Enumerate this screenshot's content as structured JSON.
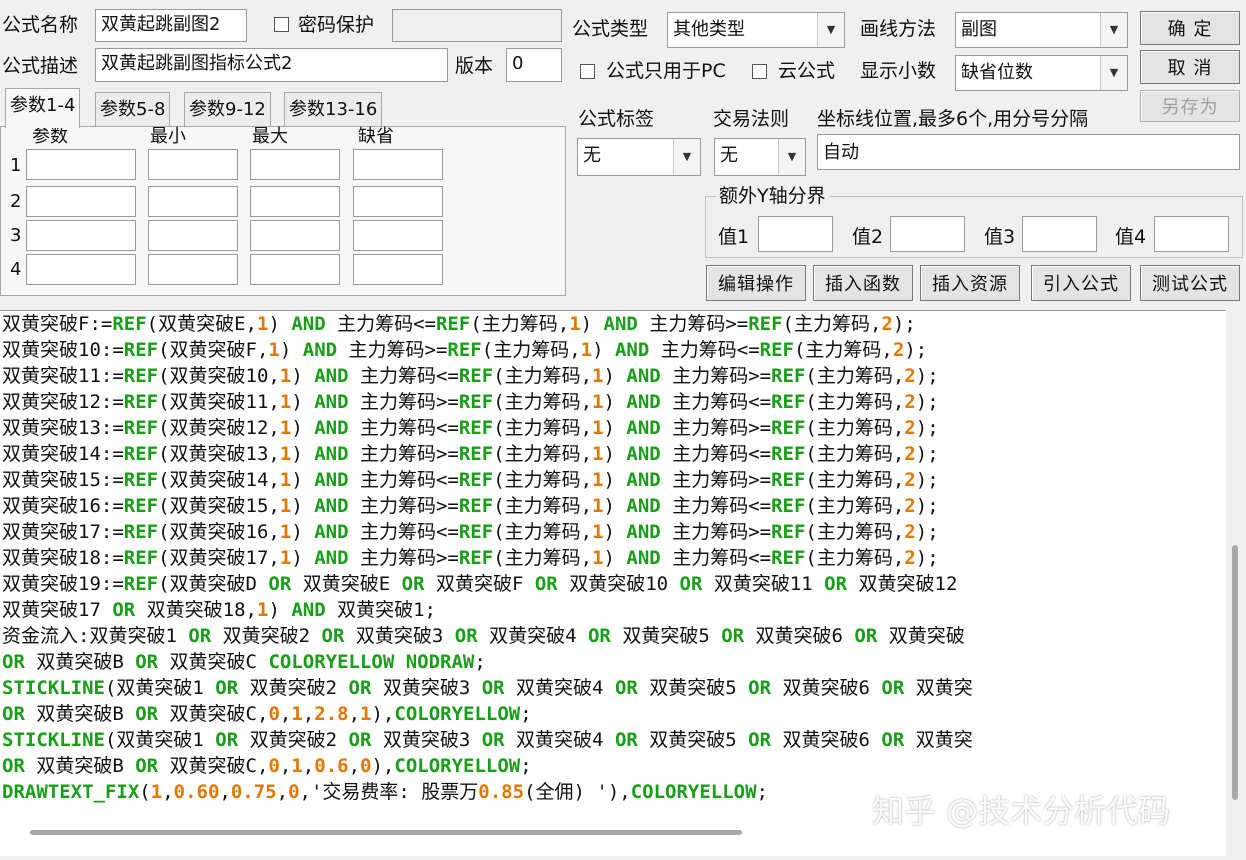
{
  "top": {
    "formula_name_label": "公式名称",
    "formula_name_value": "双黄起跳副图2",
    "password_label": "密码保护",
    "password_value": "",
    "formula_type_label": "公式类型",
    "formula_type_value": "其他类型",
    "draw_method_label": "画线方法",
    "draw_method_value": "副图",
    "ok_label": "确 定",
    "formula_desc_label": "公式描述",
    "formula_desc_value": "双黄起跳副图指标公式2",
    "version_label": "版本",
    "version_value": "0",
    "pc_only_label": "公式只用于PC",
    "cloud_label": "云公式",
    "decimal_label": "显示小数",
    "decimal_value": "缺省位数",
    "cancel_label": "取 消",
    "save_as_label": "另存为"
  },
  "params": {
    "tabs": [
      "参数1-4",
      "参数5-8",
      "参数9-12",
      "参数13-16"
    ],
    "headers": [
      "参数",
      "最小",
      "最大",
      "缺省"
    ],
    "row_numbers": [
      "1",
      "2",
      "3",
      "4"
    ]
  },
  "right": {
    "tag_label": "公式标签",
    "tag_value": "无",
    "trade_rule_label": "交易法则",
    "trade_rule_value": "无",
    "axis_label": "坐标线位置,最多6个,用分号分隔",
    "axis_value": "自动",
    "extra_y_label": "额外Y轴分界",
    "val_labels": [
      "值1",
      "值2",
      "值3",
      "值4"
    ]
  },
  "buttons": {
    "edit": "编辑操作",
    "insert_func": "插入函数",
    "insert_res": "插入资源",
    "import": "引入公式",
    "test": "测试公式"
  },
  "code": [
    [
      [
        "t",
        "双黄突破F:="
      ],
      [
        "k",
        "REF"
      ],
      [
        "t",
        "(双黄突破E,"
      ],
      [
        "n",
        "1"
      ],
      [
        "t",
        ") "
      ],
      [
        "k",
        "AND"
      ],
      [
        "t",
        " 主力筹码<="
      ],
      [
        "k",
        "REF"
      ],
      [
        "t",
        "(主力筹码,"
      ],
      [
        "n",
        "1"
      ],
      [
        "t",
        ") "
      ],
      [
        "k",
        "AND"
      ],
      [
        "t",
        " 主力筹码>="
      ],
      [
        "k",
        "REF"
      ],
      [
        "t",
        "(主力筹码,"
      ],
      [
        "n",
        "2"
      ],
      [
        "t",
        ");"
      ]
    ],
    [
      [
        "t",
        "双黄突破10:="
      ],
      [
        "k",
        "REF"
      ],
      [
        "t",
        "(双黄突破F,"
      ],
      [
        "n",
        "1"
      ],
      [
        "t",
        ") "
      ],
      [
        "k",
        "AND"
      ],
      [
        "t",
        " 主力筹码>="
      ],
      [
        "k",
        "REF"
      ],
      [
        "t",
        "(主力筹码,"
      ],
      [
        "n",
        "1"
      ],
      [
        "t",
        ") "
      ],
      [
        "k",
        "AND"
      ],
      [
        "t",
        " 主力筹码<="
      ],
      [
        "k",
        "REF"
      ],
      [
        "t",
        "(主力筹码,"
      ],
      [
        "n",
        "2"
      ],
      [
        "t",
        ");"
      ]
    ],
    [
      [
        "t",
        "双黄突破11:="
      ],
      [
        "k",
        "REF"
      ],
      [
        "t",
        "(双黄突破10,"
      ],
      [
        "n",
        "1"
      ],
      [
        "t",
        ") "
      ],
      [
        "k",
        "AND"
      ],
      [
        "t",
        " 主力筹码<="
      ],
      [
        "k",
        "REF"
      ],
      [
        "t",
        "(主力筹码,"
      ],
      [
        "n",
        "1"
      ],
      [
        "t",
        ") "
      ],
      [
        "k",
        "AND"
      ],
      [
        "t",
        " 主力筹码>="
      ],
      [
        "k",
        "REF"
      ],
      [
        "t",
        "(主力筹码,"
      ],
      [
        "n",
        "2"
      ],
      [
        "t",
        ");"
      ]
    ],
    [
      [
        "t",
        "双黄突破12:="
      ],
      [
        "k",
        "REF"
      ],
      [
        "t",
        "(双黄突破11,"
      ],
      [
        "n",
        "1"
      ],
      [
        "t",
        ") "
      ],
      [
        "k",
        "AND"
      ],
      [
        "t",
        " 主力筹码>="
      ],
      [
        "k",
        "REF"
      ],
      [
        "t",
        "(主力筹码,"
      ],
      [
        "n",
        "1"
      ],
      [
        "t",
        ") "
      ],
      [
        "k",
        "AND"
      ],
      [
        "t",
        " 主力筹码<="
      ],
      [
        "k",
        "REF"
      ],
      [
        "t",
        "(主力筹码,"
      ],
      [
        "n",
        "2"
      ],
      [
        "t",
        ");"
      ]
    ],
    [
      [
        "t",
        "双黄突破13:="
      ],
      [
        "k",
        "REF"
      ],
      [
        "t",
        "(双黄突破12,"
      ],
      [
        "n",
        "1"
      ],
      [
        "t",
        ") "
      ],
      [
        "k",
        "AND"
      ],
      [
        "t",
        " 主力筹码<="
      ],
      [
        "k",
        "REF"
      ],
      [
        "t",
        "(主力筹码,"
      ],
      [
        "n",
        "1"
      ],
      [
        "t",
        ") "
      ],
      [
        "k",
        "AND"
      ],
      [
        "t",
        " 主力筹码>="
      ],
      [
        "k",
        "REF"
      ],
      [
        "t",
        "(主力筹码,"
      ],
      [
        "n",
        "2"
      ],
      [
        "t",
        ");"
      ]
    ],
    [
      [
        "t",
        "双黄突破14:="
      ],
      [
        "k",
        "REF"
      ],
      [
        "t",
        "(双黄突破13,"
      ],
      [
        "n",
        "1"
      ],
      [
        "t",
        ") "
      ],
      [
        "k",
        "AND"
      ],
      [
        "t",
        " 主力筹码>="
      ],
      [
        "k",
        "REF"
      ],
      [
        "t",
        "(主力筹码,"
      ],
      [
        "n",
        "1"
      ],
      [
        "t",
        ") "
      ],
      [
        "k",
        "AND"
      ],
      [
        "t",
        " 主力筹码<="
      ],
      [
        "k",
        "REF"
      ],
      [
        "t",
        "(主力筹码,"
      ],
      [
        "n",
        "2"
      ],
      [
        "t",
        ");"
      ]
    ],
    [
      [
        "t",
        "双黄突破15:="
      ],
      [
        "k",
        "REF"
      ],
      [
        "t",
        "(双黄突破14,"
      ],
      [
        "n",
        "1"
      ],
      [
        "t",
        ") "
      ],
      [
        "k",
        "AND"
      ],
      [
        "t",
        " 主力筹码<="
      ],
      [
        "k",
        "REF"
      ],
      [
        "t",
        "(主力筹码,"
      ],
      [
        "n",
        "1"
      ],
      [
        "t",
        ") "
      ],
      [
        "k",
        "AND"
      ],
      [
        "t",
        " 主力筹码>="
      ],
      [
        "k",
        "REF"
      ],
      [
        "t",
        "(主力筹码,"
      ],
      [
        "n",
        "2"
      ],
      [
        "t",
        ");"
      ]
    ],
    [
      [
        "t",
        "双黄突破16:="
      ],
      [
        "k",
        "REF"
      ],
      [
        "t",
        "(双黄突破15,"
      ],
      [
        "n",
        "1"
      ],
      [
        "t",
        ") "
      ],
      [
        "k",
        "AND"
      ],
      [
        "t",
        " 主力筹码>="
      ],
      [
        "k",
        "REF"
      ],
      [
        "t",
        "(主力筹码,"
      ],
      [
        "n",
        "1"
      ],
      [
        "t",
        ") "
      ],
      [
        "k",
        "AND"
      ],
      [
        "t",
        " 主力筹码<="
      ],
      [
        "k",
        "REF"
      ],
      [
        "t",
        "(主力筹码,"
      ],
      [
        "n",
        "2"
      ],
      [
        "t",
        ");"
      ]
    ],
    [
      [
        "t",
        "双黄突破17:="
      ],
      [
        "k",
        "REF"
      ],
      [
        "t",
        "(双黄突破16,"
      ],
      [
        "n",
        "1"
      ],
      [
        "t",
        ") "
      ],
      [
        "k",
        "AND"
      ],
      [
        "t",
        " 主力筹码<="
      ],
      [
        "k",
        "REF"
      ],
      [
        "t",
        "(主力筹码,"
      ],
      [
        "n",
        "1"
      ],
      [
        "t",
        ") "
      ],
      [
        "k",
        "AND"
      ],
      [
        "t",
        " 主力筹码>="
      ],
      [
        "k",
        "REF"
      ],
      [
        "t",
        "(主力筹码,"
      ],
      [
        "n",
        "2"
      ],
      [
        "t",
        ");"
      ]
    ],
    [
      [
        "t",
        "双黄突破18:="
      ],
      [
        "k",
        "REF"
      ],
      [
        "t",
        "(双黄突破17,"
      ],
      [
        "n",
        "1"
      ],
      [
        "t",
        ") "
      ],
      [
        "k",
        "AND"
      ],
      [
        "t",
        " 主力筹码>="
      ],
      [
        "k",
        "REF"
      ],
      [
        "t",
        "(主力筹码,"
      ],
      [
        "n",
        "1"
      ],
      [
        "t",
        ") "
      ],
      [
        "k",
        "AND"
      ],
      [
        "t",
        " 主力筹码<="
      ],
      [
        "k",
        "REF"
      ],
      [
        "t",
        "(主力筹码,"
      ],
      [
        "n",
        "2"
      ],
      [
        "t",
        ");"
      ]
    ],
    [
      [
        "t",
        "双黄突破19:="
      ],
      [
        "k",
        "REF"
      ],
      [
        "t",
        "(双黄突破D "
      ],
      [
        "k",
        "OR"
      ],
      [
        "t",
        " 双黄突破E "
      ],
      [
        "k",
        "OR"
      ],
      [
        "t",
        " 双黄突破F "
      ],
      [
        "k",
        "OR"
      ],
      [
        "t",
        " 双黄突破10 "
      ],
      [
        "k",
        "OR"
      ],
      [
        "t",
        " 双黄突破11 "
      ],
      [
        "k",
        "OR"
      ],
      [
        "t",
        " 双黄突破12"
      ]
    ],
    [
      [
        "t",
        "双黄突破17 "
      ],
      [
        "k",
        "OR"
      ],
      [
        "t",
        " 双黄突破18,"
      ],
      [
        "n",
        "1"
      ],
      [
        "t",
        ") "
      ],
      [
        "k",
        "AND"
      ],
      [
        "t",
        " 双黄突破1;"
      ]
    ],
    [
      [
        "t",
        "资金流入:双黄突破1 "
      ],
      [
        "k",
        "OR"
      ],
      [
        "t",
        " 双黄突破2 "
      ],
      [
        "k",
        "OR"
      ],
      [
        "t",
        " 双黄突破3 "
      ],
      [
        "k",
        "OR"
      ],
      [
        "t",
        " 双黄突破4 "
      ],
      [
        "k",
        "OR"
      ],
      [
        "t",
        " 双黄突破5 "
      ],
      [
        "k",
        "OR"
      ],
      [
        "t",
        " 双黄突破6 "
      ],
      [
        "k",
        "OR"
      ],
      [
        "t",
        " 双黄突破"
      ]
    ],
    [
      [
        "k",
        "OR"
      ],
      [
        "t",
        " 双黄突破B "
      ],
      [
        "k",
        "OR"
      ],
      [
        "t",
        " 双黄突破C "
      ],
      [
        "k",
        "COLORYELLOW NODRAW"
      ],
      [
        "t",
        ";"
      ]
    ],
    [
      [
        "k",
        "STICKLINE"
      ],
      [
        "t",
        "(双黄突破1 "
      ],
      [
        "k",
        "OR"
      ],
      [
        "t",
        " 双黄突破2 "
      ],
      [
        "k",
        "OR"
      ],
      [
        "t",
        " 双黄突破3 "
      ],
      [
        "k",
        "OR"
      ],
      [
        "t",
        " 双黄突破4 "
      ],
      [
        "k",
        "OR"
      ],
      [
        "t",
        " 双黄突破5 "
      ],
      [
        "k",
        "OR"
      ],
      [
        "t",
        " 双黄突破6 "
      ],
      [
        "k",
        "OR"
      ],
      [
        "t",
        " 双黄突"
      ]
    ],
    [
      [
        "k",
        "OR"
      ],
      [
        "t",
        " 双黄突破B "
      ],
      [
        "k",
        "OR"
      ],
      [
        "t",
        " 双黄突破C,"
      ],
      [
        "n",
        "0"
      ],
      [
        "t",
        ","
      ],
      [
        "n",
        "1"
      ],
      [
        "t",
        ","
      ],
      [
        "n",
        "2.8"
      ],
      [
        "t",
        ","
      ],
      [
        "n",
        "1"
      ],
      [
        "t",
        "),"
      ],
      [
        "k",
        "COLORYELLOW"
      ],
      [
        "t",
        ";"
      ]
    ],
    [
      [
        "k",
        "STICKLINE"
      ],
      [
        "t",
        "(双黄突破1 "
      ],
      [
        "k",
        "OR"
      ],
      [
        "t",
        " 双黄突破2 "
      ],
      [
        "k",
        "OR"
      ],
      [
        "t",
        " 双黄突破3 "
      ],
      [
        "k",
        "OR"
      ],
      [
        "t",
        " 双黄突破4 "
      ],
      [
        "k",
        "OR"
      ],
      [
        "t",
        " 双黄突破5 "
      ],
      [
        "k",
        "OR"
      ],
      [
        "t",
        " 双黄突破6 "
      ],
      [
        "k",
        "OR"
      ],
      [
        "t",
        " 双黄突"
      ]
    ],
    [
      [
        "k",
        "OR"
      ],
      [
        "t",
        " 双黄突破B "
      ],
      [
        "k",
        "OR"
      ],
      [
        "t",
        " 双黄突破C,"
      ],
      [
        "n",
        "0"
      ],
      [
        "t",
        ","
      ],
      [
        "n",
        "1"
      ],
      [
        "t",
        ","
      ],
      [
        "n",
        "0.6"
      ],
      [
        "t",
        ","
      ],
      [
        "n",
        "0"
      ],
      [
        "t",
        "),"
      ],
      [
        "k",
        "COLORYELLOW"
      ],
      [
        "t",
        ";"
      ]
    ],
    [
      [
        "k",
        "DRAWTEXT_FIX"
      ],
      [
        "t",
        "("
      ],
      [
        "n",
        "1"
      ],
      [
        "t",
        ","
      ],
      [
        "n",
        "0.60"
      ],
      [
        "t",
        ","
      ],
      [
        "n",
        "0.75"
      ],
      [
        "t",
        ","
      ],
      [
        "n",
        "0"
      ],
      [
        "t",
        ",'交易费率: 股票万"
      ],
      [
        "n",
        "0.85"
      ],
      [
        "t",
        "(全佣) '),"
      ],
      [
        "k",
        "COLORYELLOW"
      ],
      [
        "t",
        ";"
      ]
    ]
  ],
  "watermark": "知乎 @技术分析代码",
  "colors": {
    "keyword": "#1a9e1a",
    "number": "#e07800",
    "text": "#111111"
  }
}
